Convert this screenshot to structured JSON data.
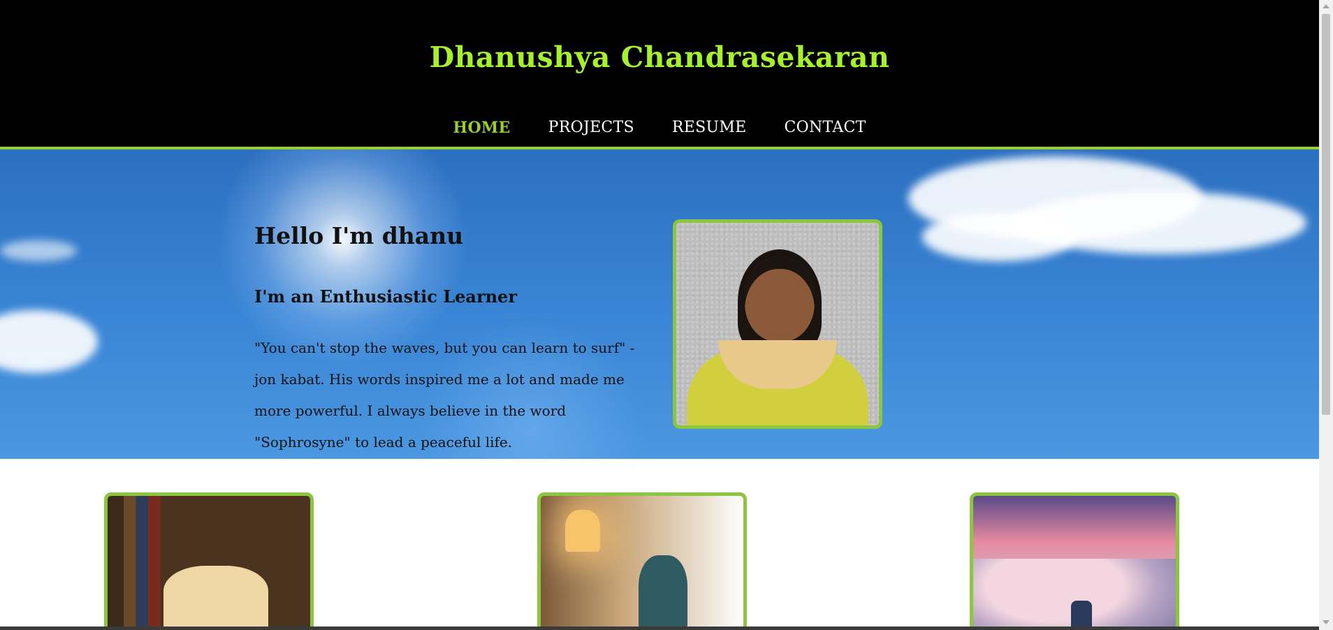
{
  "site": {
    "title": "Dhanushya Chandrasekaran"
  },
  "nav": {
    "items": [
      {
        "label": "HOME",
        "active": true
      },
      {
        "label": "PROJECTS",
        "active": false
      },
      {
        "label": "RESUME",
        "active": false
      },
      {
        "label": "CONTACT",
        "active": false
      }
    ]
  },
  "hero": {
    "greeting": "Hello I'm dhanu",
    "subtitle": "I'm an Enthusiastic Learner",
    "quote": "\"You can't stop the waves, but you can learn to surf\" - jon kabat. His words inspired me a lot and made me more powerful. I always believe in the word \"Sophrosyne\" to lead a peaceful life."
  },
  "colors": {
    "accent": "#9acd32",
    "title": "#a6f02e",
    "header_bg": "#000000"
  }
}
